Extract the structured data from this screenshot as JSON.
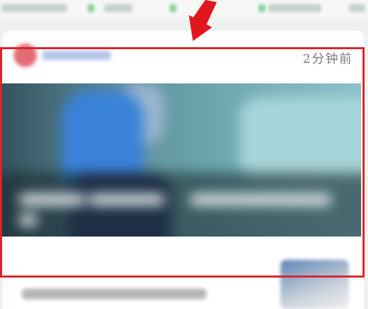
{
  "feed_card": {
    "timestamp": "2分钟前"
  },
  "colors": {
    "highlight": "#d9242b",
    "arrow": "#e0171f"
  }
}
